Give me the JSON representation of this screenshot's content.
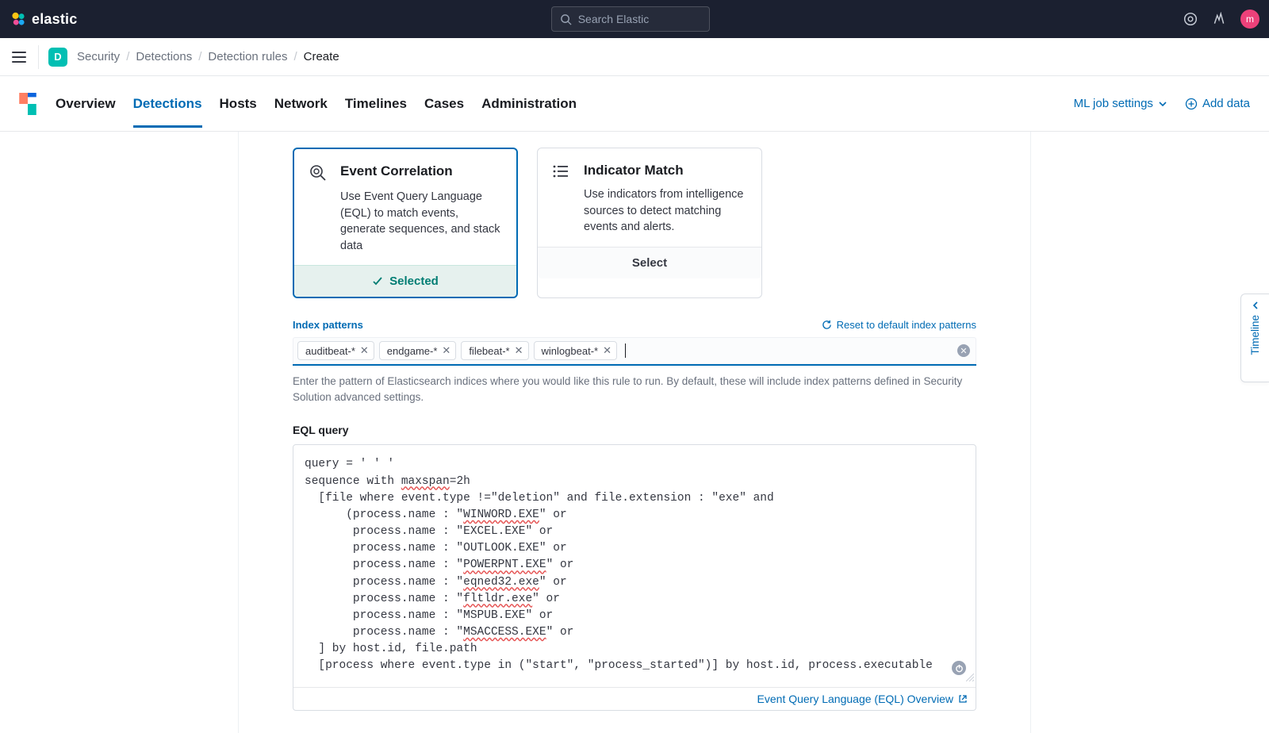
{
  "brand": "elastic",
  "search": {
    "placeholder": "Search Elastic"
  },
  "avatar": "m",
  "space_badge": "D",
  "breadcrumbs": [
    "Security",
    "Detections",
    "Detection rules",
    "Create"
  ],
  "nav": {
    "tabs": [
      "Overview",
      "Detections",
      "Hosts",
      "Network",
      "Timelines",
      "Cases",
      "Administration"
    ],
    "active": "Detections",
    "actions": {
      "ml": "ML job settings",
      "add_data": "Add data"
    }
  },
  "cards": {
    "eql": {
      "title": "Event Correlation",
      "desc": "Use Event Query Language (EQL) to match events, generate sequences, and stack data",
      "footer": "Selected"
    },
    "ioc": {
      "title": "Indicator Match",
      "desc": "Use indicators from intelligence sources to detect matching events and alerts.",
      "footer": "Select"
    }
  },
  "index": {
    "label": "Index patterns",
    "reset": "Reset to default index patterns",
    "pills": [
      "auditbeat-*",
      "endgame-*",
      "filebeat-*",
      "winlogbeat-*"
    ],
    "help": "Enter the pattern of Elasticsearch indices where you would like this rule to run. By default, these will include index patterns defined in Security Solution advanced settings."
  },
  "eql_query": {
    "label": "EQL query",
    "link": "Event Query Language (EQL) Overview"
  },
  "timeline": "Timeline"
}
